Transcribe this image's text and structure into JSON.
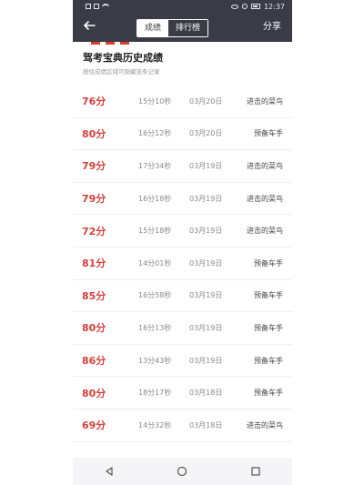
{
  "status_bar": {
    "time": "12:37"
  },
  "nav": {
    "back_icon": "arrow-left-icon",
    "tabs": [
      {
        "label": "成绩",
        "active": true
      },
      {
        "label": "排行榜",
        "active": false
      }
    ],
    "share_label": "分享"
  },
  "header": {
    "title": "驾考宝典历史成绩",
    "subtitle": "按住成绩区域可隐藏该条记录"
  },
  "rows": [
    {
      "score": "76分",
      "duration": "15分10秒",
      "date": "03月20日",
      "rank": "进击的菜鸟"
    },
    {
      "score": "80分",
      "duration": "16分12秒",
      "date": "03月20日",
      "rank": "预备车手"
    },
    {
      "score": "79分",
      "duration": "17分34秒",
      "date": "03月19日",
      "rank": "进击的菜鸟"
    },
    {
      "score": "79分",
      "duration": "16分18秒",
      "date": "03月19日",
      "rank": "进击的菜鸟"
    },
    {
      "score": "72分",
      "duration": "15分18秒",
      "date": "03月19日",
      "rank": "进击的菜鸟"
    },
    {
      "score": "81分",
      "duration": "14分01秒",
      "date": "03月19日",
      "rank": "预备车手"
    },
    {
      "score": "85分",
      "duration": "16分58秒",
      "date": "03月19日",
      "rank": "预备车手"
    },
    {
      "score": "80分",
      "duration": "16分13秒",
      "date": "03月19日",
      "rank": "预备车手"
    },
    {
      "score": "86分",
      "duration": "13分43秒",
      "date": "03月19日",
      "rank": "预备车手"
    },
    {
      "score": "80分",
      "duration": "18分17秒",
      "date": "03月18日",
      "rank": "预备车手"
    },
    {
      "score": "69分",
      "duration": "14分32秒",
      "date": "03月18日",
      "rank": "进击的菜鸟"
    }
  ],
  "colors": {
    "navbar": "#3a3b45",
    "score": "#d9403b",
    "accent": "#e23a2a"
  }
}
